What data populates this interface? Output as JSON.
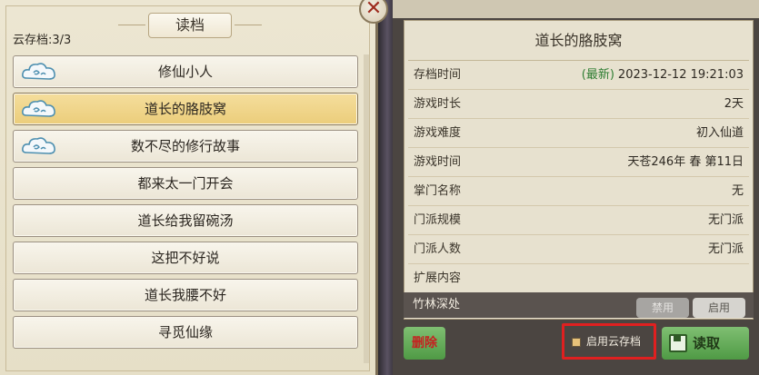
{
  "left": {
    "title": "读档",
    "cloud_count": "云存档:3/3",
    "slots": [
      {
        "name": "修仙小人",
        "cloud": true,
        "selected": false
      },
      {
        "name": "道长的胳肢窝",
        "cloud": true,
        "selected": true
      },
      {
        "name": "数不尽的修行故事",
        "cloud": true,
        "selected": false
      },
      {
        "name": "都来太一门开会",
        "cloud": false,
        "selected": false
      },
      {
        "name": "道长给我留碗汤",
        "cloud": false,
        "selected": false
      },
      {
        "name": "这把不好说",
        "cloud": false,
        "selected": false
      },
      {
        "name": "道长我腰不好",
        "cloud": false,
        "selected": false
      },
      {
        "name": "寻觅仙缘",
        "cloud": false,
        "selected": false
      }
    ]
  },
  "right": {
    "save_title": "道长的胳肢窝",
    "rows": [
      {
        "label": "存档时间",
        "latest": "(最新)",
        "value": "2023-12-12 19:21:03"
      },
      {
        "label": "游戏时长",
        "latest": "",
        "value": "2天"
      },
      {
        "label": "游戏难度",
        "latest": "",
        "value": "初入仙道"
      },
      {
        "label": "游戏时间",
        "latest": "",
        "value": "天苍246年 春 第11日"
      },
      {
        "label": "掌门名称",
        "latest": "",
        "value": "无"
      },
      {
        "label": "门派规模",
        "latest": "",
        "value": "无门派"
      },
      {
        "label": "门派人数",
        "latest": "",
        "value": "无门派"
      },
      {
        "label": "扩展内容",
        "latest": "",
        "value": ""
      }
    ],
    "mod": {
      "name": "竹林深处",
      "disable_label": "禁用",
      "enable_label": "启用"
    },
    "buttons": {
      "delete": "删除",
      "cloud_toggle": "启用云存档",
      "read": "读取"
    }
  },
  "close": "✕",
  "colors": {
    "selected": "#ebcd7b",
    "latest": "#2e7d32",
    "highlight": "#e02020"
  },
  "icons": [
    "cloud-icon",
    "close-icon",
    "disk-icon"
  ]
}
